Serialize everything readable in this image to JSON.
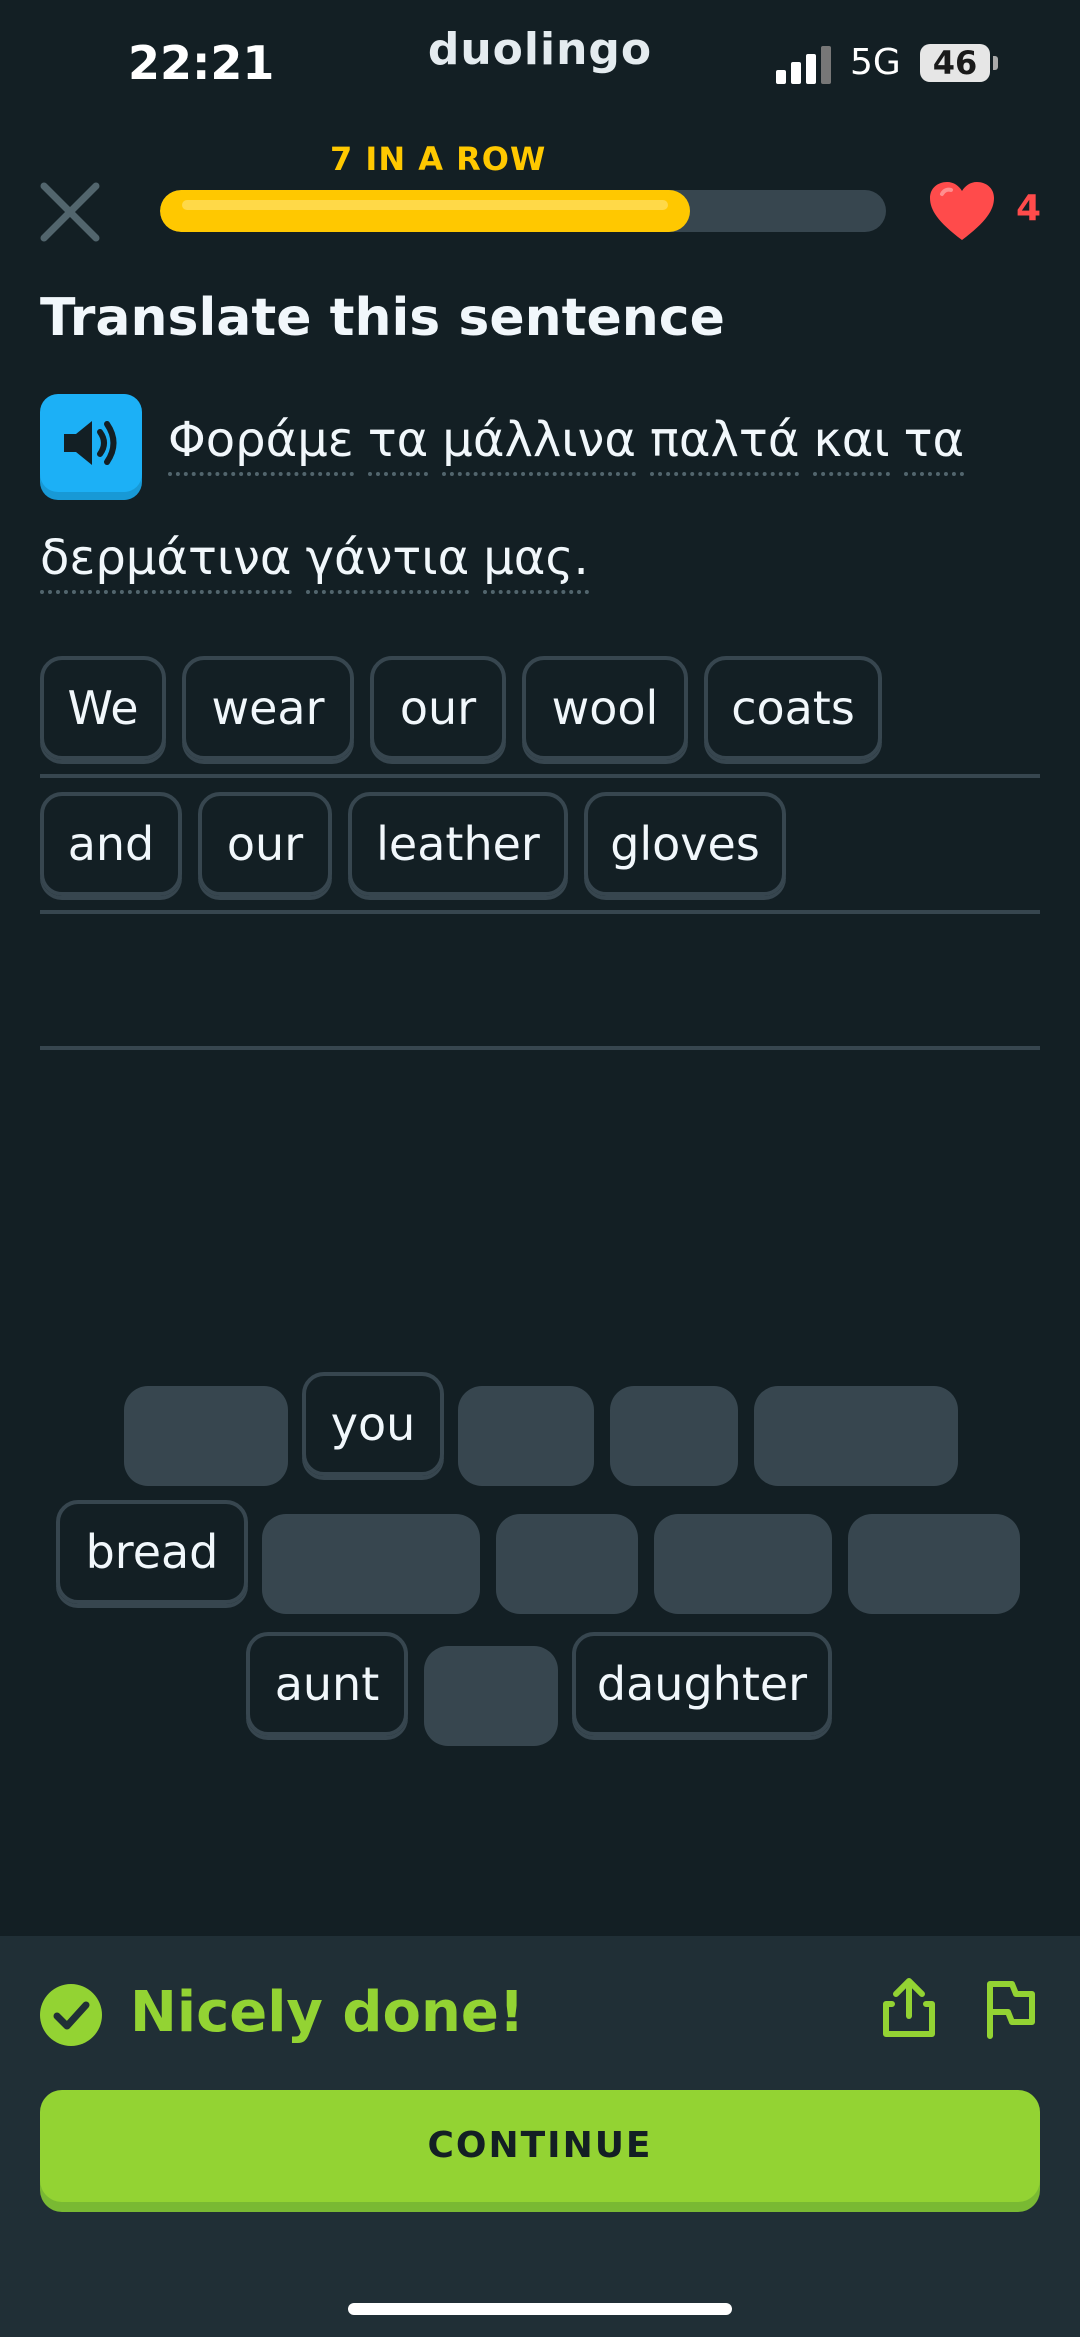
{
  "status_bar": {
    "time": "22:21",
    "app_name": "duolingo",
    "network": "5G",
    "battery": "46"
  },
  "header": {
    "streak_label": "7 IN A ROW",
    "progress": 0.73,
    "hearts": "4"
  },
  "prompt": {
    "instruction": "Translate this sentence",
    "line1_words": [
      "Φοράμε",
      "τα",
      "μάλλινα",
      "παλτά",
      "και",
      "τα"
    ],
    "line2_words": [
      "δερμάτινα",
      "γάντια",
      "μας."
    ]
  },
  "answer": {
    "row1": [
      "We",
      "wear",
      "our",
      "wool",
      "coats"
    ],
    "row2": [
      "and",
      "our",
      "leather",
      "gloves"
    ]
  },
  "word_bank": {
    "you": "you",
    "bread": "bread",
    "aunt": "aunt",
    "daughter": "daughter"
  },
  "footer": {
    "feedback": "Nicely done!",
    "continue_label": "CONTINUE"
  },
  "colors": {
    "background": "#131f24",
    "accent_green": "#93d333",
    "streak_yellow": "#ffc800",
    "heart_red": "#ff4b4b",
    "speaker_blue": "#1cb0f6"
  },
  "icons": [
    "close-icon",
    "heart-icon",
    "speaker-icon",
    "checkmark-icon",
    "share-icon",
    "flag-icon"
  ]
}
